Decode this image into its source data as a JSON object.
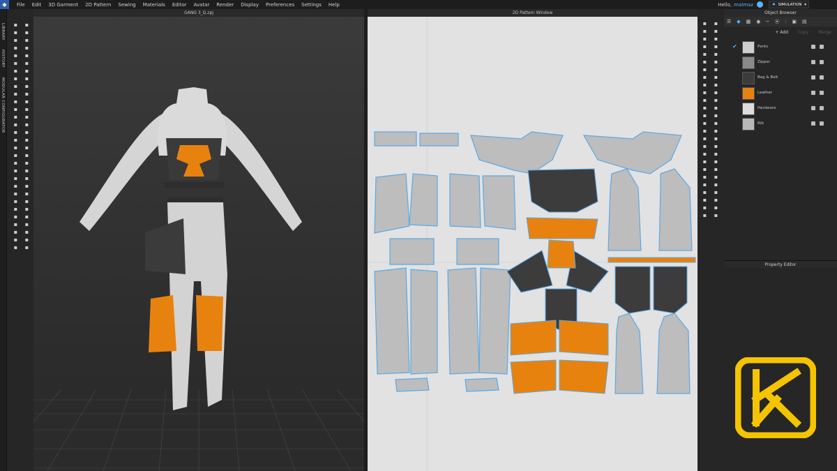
{
  "menu": {
    "items": [
      "File",
      "Edit",
      "3D Garment",
      "2D Pattern",
      "Sewing",
      "Materials",
      "Editor",
      "Avatar",
      "Render",
      "Display",
      "Preferences",
      "Settings",
      "Help"
    ],
    "hello": "Hello,",
    "user": "malmaz",
    "mode": "SIMULATION"
  },
  "side_tabs": [
    "LIBRARY",
    "HISTORY",
    "MODULAR CONFIGURATOR"
  ],
  "viewport3d": {
    "title": "GANG 3_Q.zpj"
  },
  "viewport2d": {
    "title": "2D Pattern Window"
  },
  "object_browser": {
    "title": "Object Browser",
    "add_label": "+ Add",
    "copy_label": "Copy",
    "merge_label": "Merge",
    "fabrics": [
      {
        "name": "Pants",
        "color": "#cfcfcf",
        "checked": true
      },
      {
        "name": "Zipper",
        "color": "#8a8a8a",
        "checked": false
      },
      {
        "name": "Bag & Belt",
        "color": "#3c3c3c",
        "checked": false
      },
      {
        "name": "Leather",
        "color": "#e8820e",
        "checked": false
      },
      {
        "name": "Hardware",
        "color": "#dcdcdc",
        "checked": false
      },
      {
        "name": "Rib",
        "color": "#b8b8b8",
        "checked": false
      }
    ]
  },
  "property_editor": {
    "title": "Property Editor"
  },
  "colors": {
    "accent": "#58b4ff",
    "orange": "#e8820e",
    "logo": "#f5c400",
    "panel": "#262626"
  }
}
